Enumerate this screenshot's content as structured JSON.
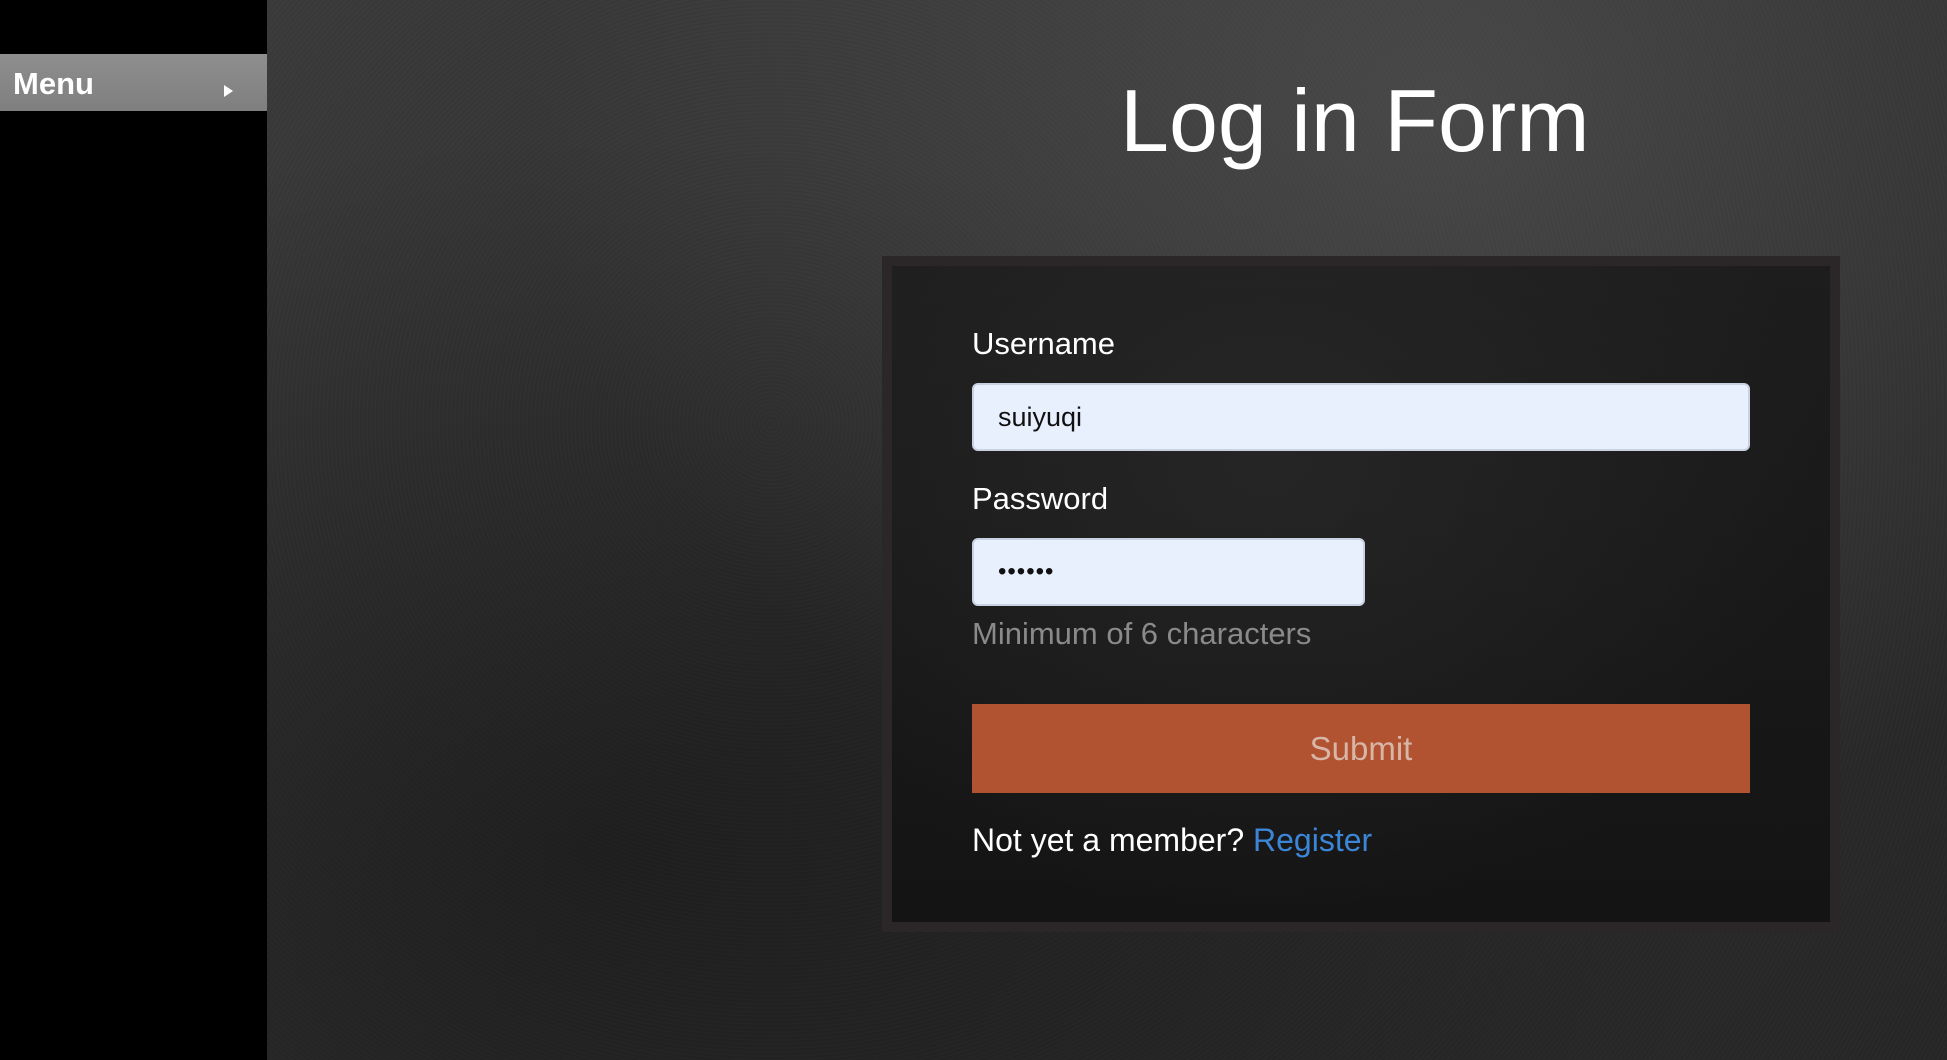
{
  "sidebar": {
    "menu_label": "Menu",
    "menu_icon": "chevron-right-icon"
  },
  "main": {
    "title": "Log in Form"
  },
  "form": {
    "username_label": "Username",
    "username_value": "suiyuqi",
    "password_label": "Password",
    "password_value": "••••••",
    "password_hint": "Minimum of 6 characters",
    "submit_label": "Submit",
    "member_prompt": "Not yet a member?",
    "register_label": "Register"
  },
  "colors": {
    "submit_bg": "#b15231",
    "link": "#3b86d6",
    "input_bg": "#e8f0fe"
  }
}
